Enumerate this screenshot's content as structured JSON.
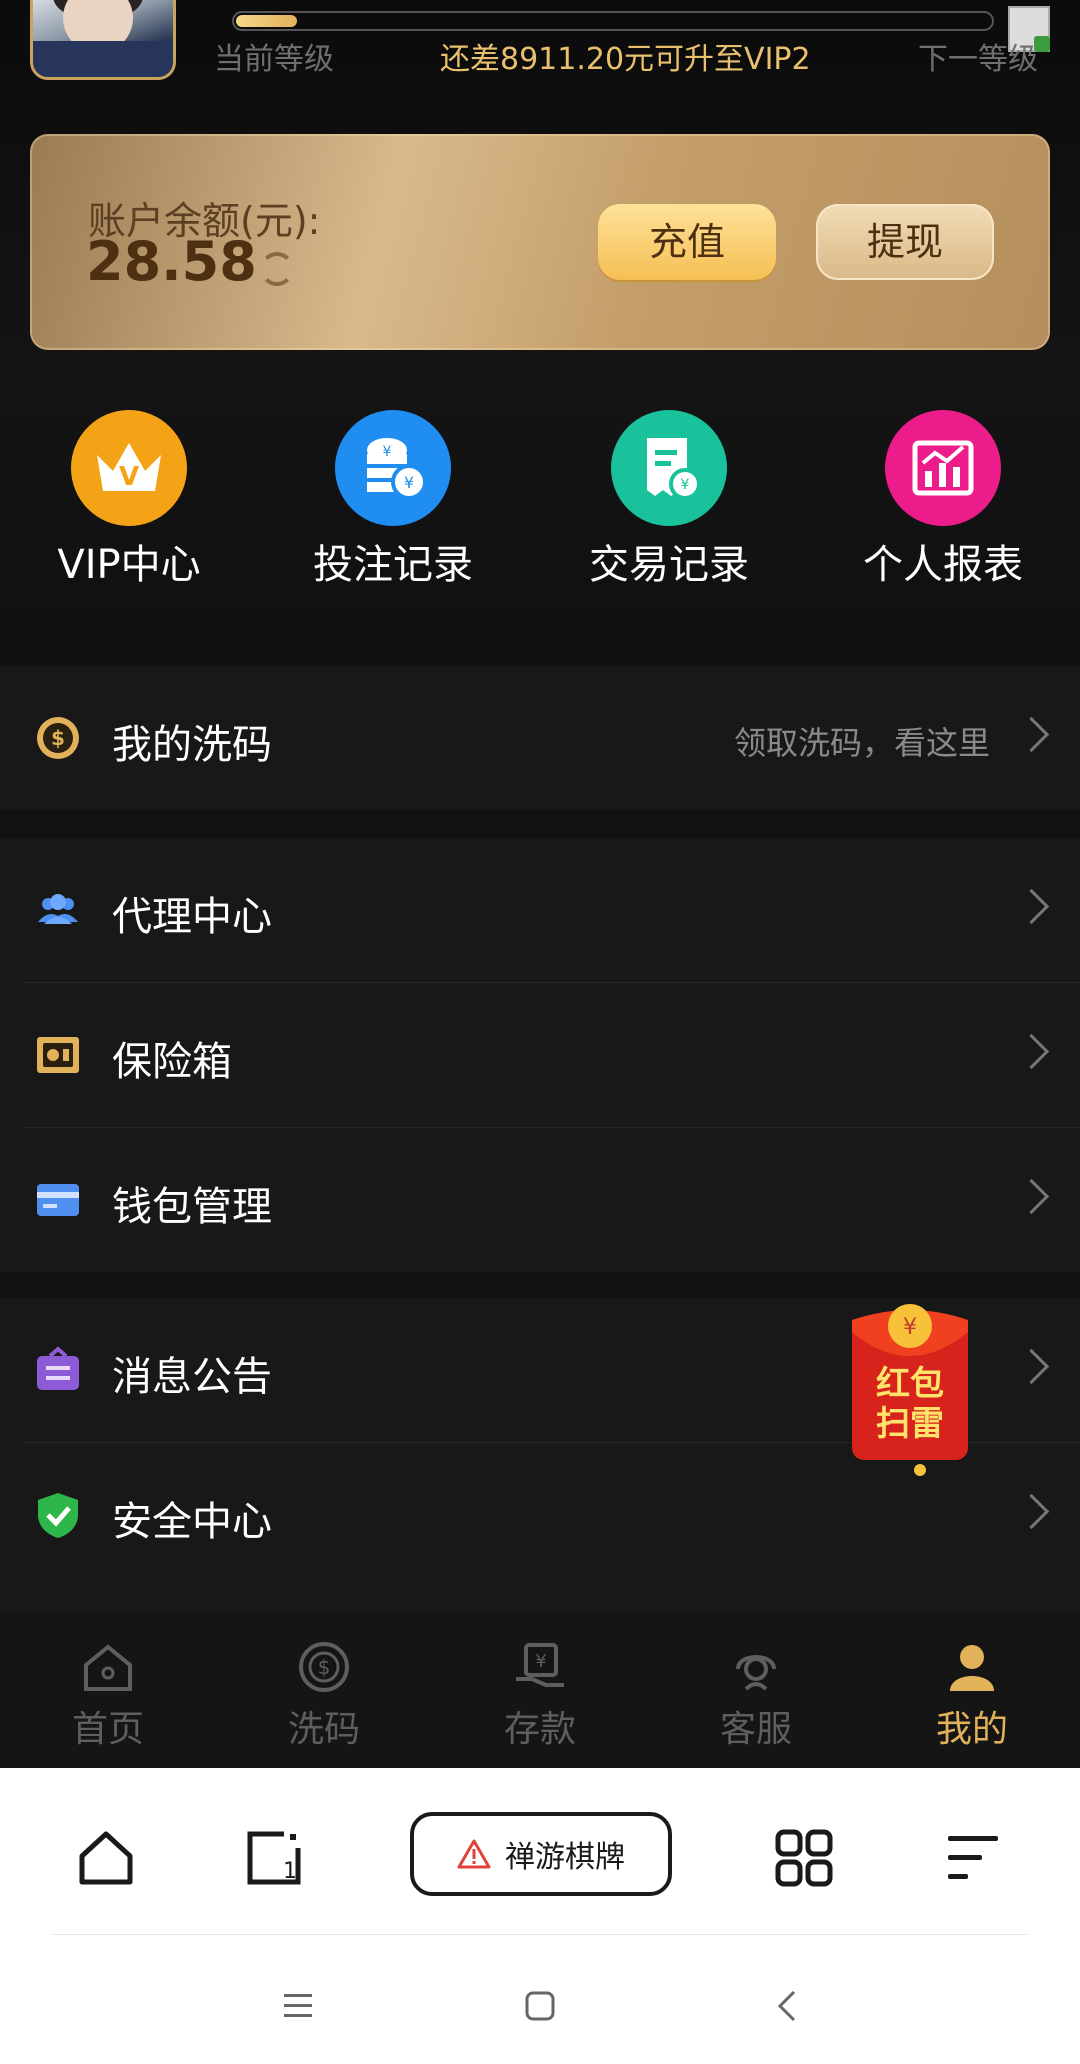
{
  "level": {
    "current_label": "当前等级",
    "message": "还差8911.20元可升至VIP2",
    "next_label": "下一等级",
    "progress": 0.08
  },
  "account": {
    "label": "账户余额(元):",
    "balance": "28.58",
    "recharge": "充值",
    "withdraw": "提现"
  },
  "quick_links": [
    {
      "label": "VIP中心",
      "icon": "crown-icon",
      "color": "#f5a316"
    },
    {
      "label": "投注记录",
      "icon": "coins-icon",
      "color": "#1f8ef0"
    },
    {
      "label": "交易记录",
      "icon": "receipt-icon",
      "color": "#19c29a"
    },
    {
      "label": "个人报表",
      "icon": "chart-icon",
      "color": "#ec1c8a"
    }
  ],
  "menu": {
    "wash": {
      "label": "我的洗码",
      "hint": "领取洗码，看这里"
    },
    "agent": {
      "label": "代理中心"
    },
    "safe": {
      "label": "保险箱"
    },
    "wallet": {
      "label": "钱包管理"
    },
    "notice": {
      "label": "消息公告"
    },
    "security": {
      "label": "安全中心"
    }
  },
  "red_packet": {
    "line1": "红包",
    "line2": "扫雷"
  },
  "tabs": [
    {
      "label": "首页"
    },
    {
      "label": "洗码"
    },
    {
      "label": "存款"
    },
    {
      "label": "客服"
    },
    {
      "label": "我的"
    }
  ],
  "browser": {
    "site_label": "禅游棋牌"
  },
  "colors": {
    "gold": "#e2b25a",
    "accent_text": "#e9c16e"
  }
}
